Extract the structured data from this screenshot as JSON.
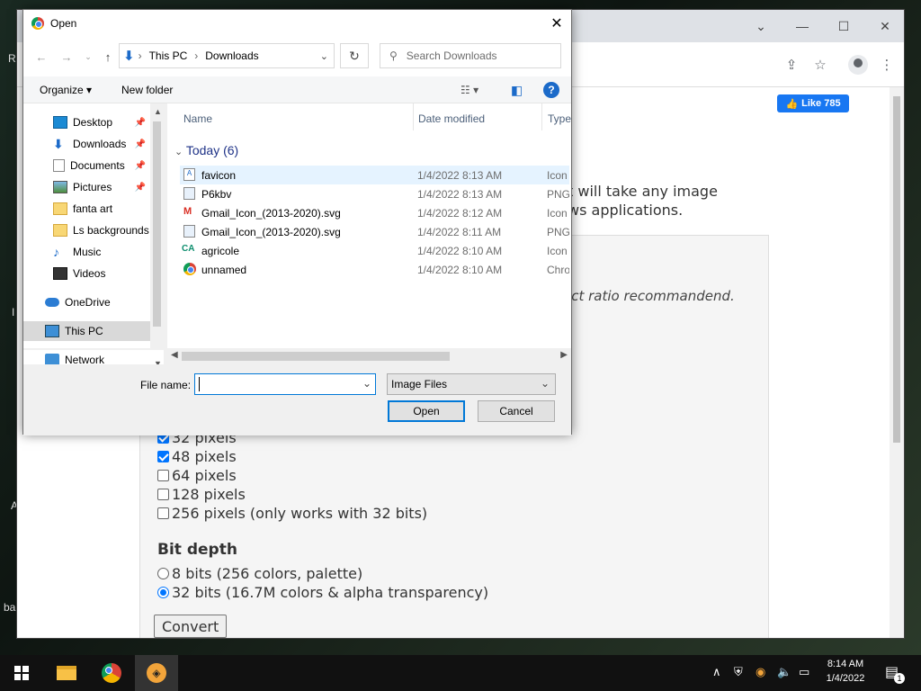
{
  "desktop": {
    "partial_letters": [
      "R",
      "I",
      "A",
      "ba"
    ]
  },
  "browser": {
    "like_button": "Like 785",
    "page_text_line1": "t will take any image",
    "page_text_line2": "ws applications.",
    "panel_hint": "ect ratio recommandend.",
    "sizes": [
      {
        "label": "32 pixels",
        "checked": true
      },
      {
        "label": "48 pixels",
        "checked": true
      },
      {
        "label": "64 pixels",
        "checked": false
      },
      {
        "label": "128 pixels",
        "checked": false
      },
      {
        "label": "256 pixels (only works with 32 bits)",
        "checked": false
      }
    ],
    "bit_depth_heading": "Bit depth",
    "bit_options": [
      {
        "label": "8 bits (256 colors, palette)",
        "checked": false
      },
      {
        "label": "32 bits (16.7M colors & alpha transparency)",
        "checked": true
      }
    ],
    "convert_label": "Convert"
  },
  "dialog": {
    "title": "Open",
    "breadcrumb": [
      "This PC",
      "Downloads"
    ],
    "search_placeholder": "Search Downloads",
    "organize_label": "Organize",
    "new_folder_label": "New folder",
    "nav_items": [
      {
        "label": "Desktop",
        "icon": "desktop-icon",
        "pinned": true
      },
      {
        "label": "Downloads",
        "icon": "downloads-icon",
        "pinned": true
      },
      {
        "label": "Documents",
        "icon": "documents-icon",
        "pinned": true
      },
      {
        "label": "Pictures",
        "icon": "pictures-icon",
        "pinned": true
      },
      {
        "label": "fanta art",
        "icon": "folder-icon",
        "pinned": false
      },
      {
        "label": "Ls backgrounds",
        "icon": "folder-icon",
        "pinned": false
      },
      {
        "label": "Music",
        "icon": "music-icon",
        "pinned": false
      },
      {
        "label": "Videos",
        "icon": "videos-icon",
        "pinned": false
      },
      {
        "label": "OneDrive",
        "icon": "onedrive-icon",
        "pinned": false
      },
      {
        "label": "This PC",
        "icon": "this-pc-icon",
        "pinned": false
      },
      {
        "label": "Network",
        "icon": "network-icon",
        "pinned": false
      }
    ],
    "columns": {
      "name": "Name",
      "date": "Date modified",
      "type": "Type"
    },
    "group_label": "Today (6)",
    "files": [
      {
        "name": "favicon",
        "date": "1/4/2022 8:13 AM",
        "type": "Icon",
        "icon": "ico-file-icon",
        "highlighted": true
      },
      {
        "name": "P6kbv",
        "date": "1/4/2022 8:13 AM",
        "type": "PNG",
        "icon": "png-file-icon",
        "highlighted": false
      },
      {
        "name": "Gmail_Icon_(2013-2020).svg",
        "date": "1/4/2022 8:12 AM",
        "type": "Icon",
        "icon": "gmail-icon",
        "highlighted": false
      },
      {
        "name": "Gmail_Icon_(2013-2020).svg",
        "date": "1/4/2022 8:11 AM",
        "type": "PNG",
        "icon": "png-file-icon",
        "highlighted": false
      },
      {
        "name": "agricole",
        "date": "1/4/2022 8:10 AM",
        "type": "Icon",
        "icon": "agricole-icon",
        "highlighted": false
      },
      {
        "name": "unnamed",
        "date": "1/4/2022 8:10 AM",
        "type": "Chro",
        "icon": "chrome-icon",
        "highlighted": false
      }
    ],
    "file_name_label": "File name:",
    "file_name_value": "",
    "file_type": "Image Files",
    "open_label": "Open",
    "cancel_label": "Cancel"
  },
  "taskbar": {
    "time": "8:14 AM",
    "date": "1/4/2022",
    "notification_count": "1"
  }
}
